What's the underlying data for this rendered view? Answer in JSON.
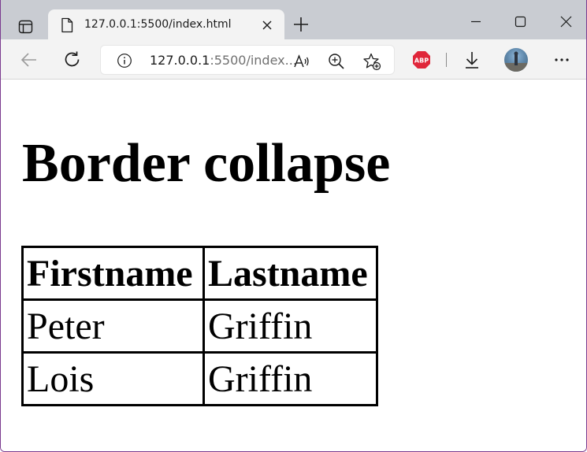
{
  "browser": {
    "tab": {
      "title": "127.0.0.1:5500/index.html"
    },
    "address": {
      "host": "127.0.0.1",
      "path": ":5500/index..."
    },
    "extensions": {
      "abp_label": "ABP"
    }
  },
  "page": {
    "title": "Border collapse",
    "table": {
      "headers": [
        "Firstname",
        "Lastname"
      ],
      "rows": [
        [
          "Peter",
          "Griffin"
        ],
        [
          "Lois",
          "Griffin"
        ]
      ]
    }
  },
  "colors": {
    "tabbar_bg": "#c9ccd2",
    "toolbar_bg": "#f3f3f3",
    "abp_red": "#e0263a"
  }
}
